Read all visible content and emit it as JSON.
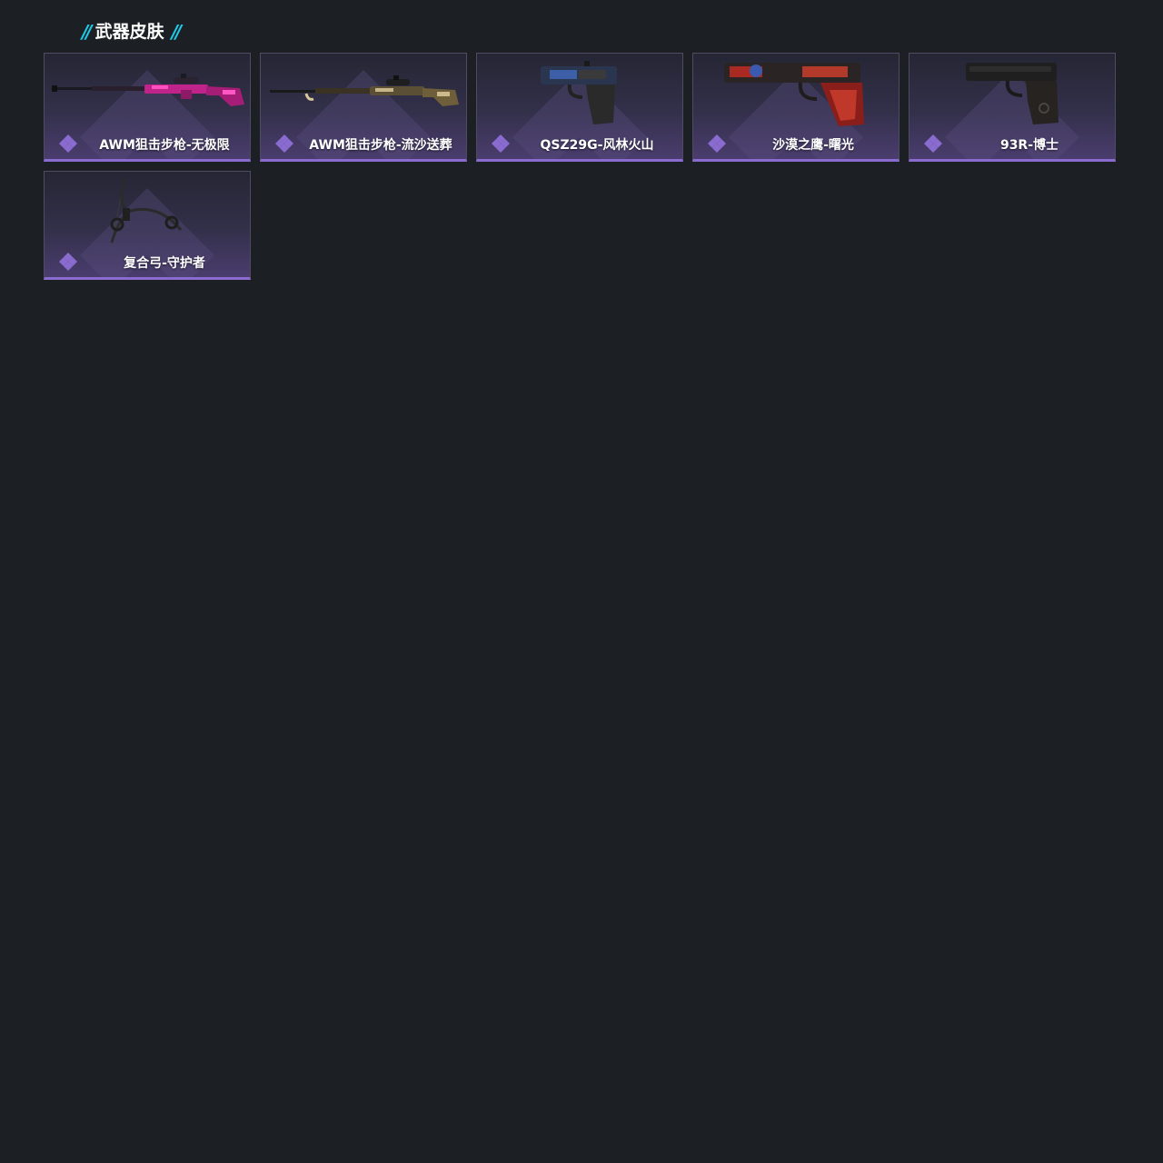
{
  "section": {
    "title": "武器皮肤",
    "accent_color": "#1ec8e6"
  },
  "colors": {
    "page_bg": "#1c2024",
    "card_border": "#4d4c63",
    "rarity_purple": "#8a6bd0"
  },
  "skins": [
    {
      "name": "AWM狙击步枪-无极限",
      "icon": "sniper-rifle-icon"
    },
    {
      "name": "AWM狙击步枪-流沙送葬",
      "icon": "sniper-rifle-icon"
    },
    {
      "name": "QSZ29G-风林火山",
      "icon": "pistol-icon"
    },
    {
      "name": "沙漠之鹰-曙光",
      "icon": "desert-eagle-icon"
    },
    {
      "name": "93R-博士",
      "icon": "pistol-icon"
    },
    {
      "name": "复合弓-守护者",
      "icon": "compound-bow-icon"
    }
  ]
}
